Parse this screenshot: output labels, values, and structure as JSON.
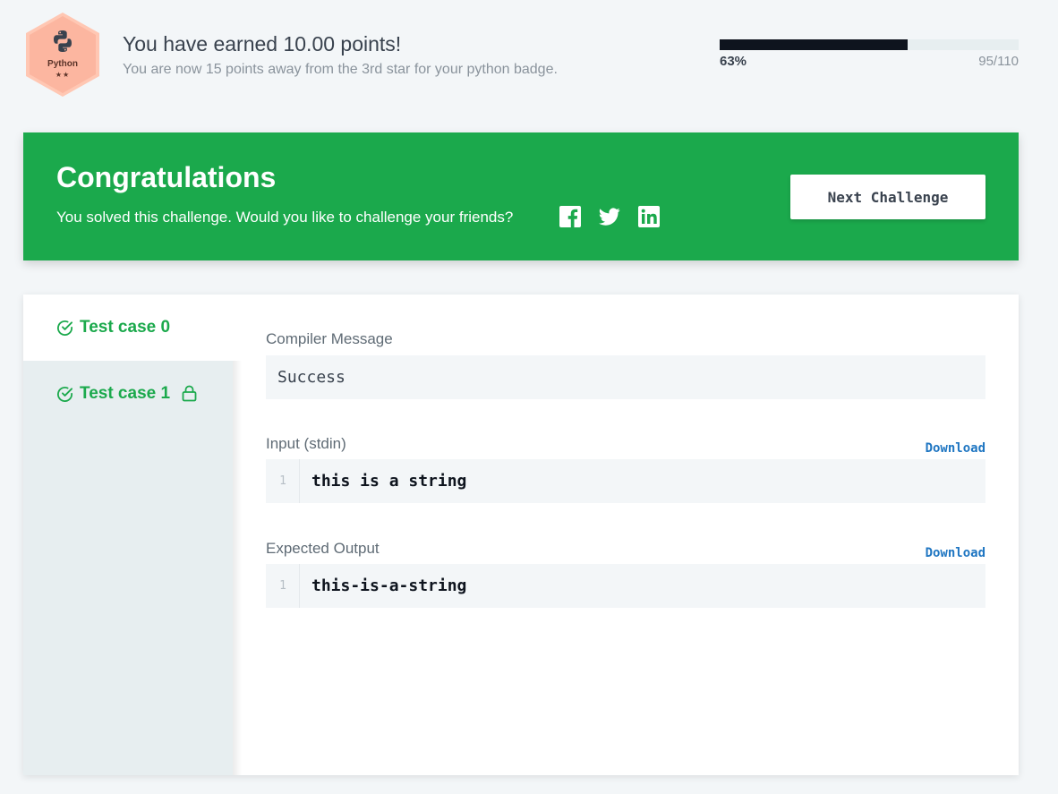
{
  "badge": {
    "name": "Python",
    "stars": "★★",
    "color": "#fcb6a0"
  },
  "header": {
    "earned": "You have earned 10.00 points!",
    "subtitle": "You are now 15 points away from the 3rd star for your python badge.",
    "progress_percent_label": "63%",
    "progress_fraction": 0.63,
    "progress_count": "95/110"
  },
  "banner": {
    "title": "Congratulations",
    "message": "You solved this challenge. Would you like to challenge your friends?",
    "next_button": "Next Challenge",
    "social_icons": [
      "facebook-icon",
      "twitter-icon",
      "linkedin-icon"
    ],
    "color": "#1ba94c"
  },
  "tests": {
    "tabs": [
      {
        "label": "Test case 0",
        "status": "passed",
        "locked": false,
        "active": true
      },
      {
        "label": "Test case 1",
        "status": "passed",
        "locked": true,
        "active": false
      }
    ]
  },
  "results": {
    "compiler_label": "Compiler Message",
    "compiler_message": "Success",
    "input_label": "Input (stdin)",
    "input_download": "Download",
    "input_line_number": "1",
    "input_line": "this is a string",
    "output_label": "Expected Output",
    "output_download": "Download",
    "output_line_number": "1",
    "output_line": "this-is-a-string"
  }
}
